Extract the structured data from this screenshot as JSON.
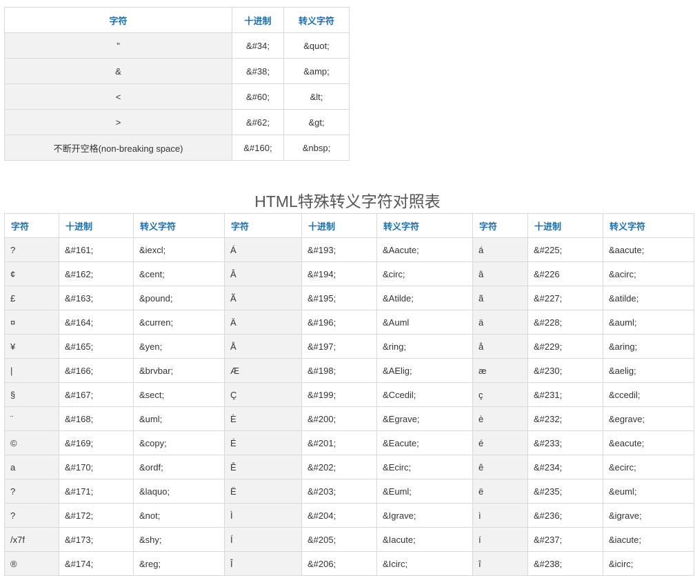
{
  "top_table": {
    "headers": [
      "字符",
      "十进制",
      "转义字符"
    ],
    "rows": [
      [
        "\"",
        "&#34;",
        "&quot;"
      ],
      [
        "&",
        "&#38;",
        "&amp;"
      ],
      [
        "<",
        "&#60;",
        "&lt;"
      ],
      [
        ">",
        "&#62;",
        "&gt;"
      ],
      [
        "不断开空格(non-breaking space)",
        "&#160;",
        "&nbsp;"
      ]
    ]
  },
  "title": "HTML特殊转义字符对照表",
  "main_table": {
    "headers": [
      "字符",
      "十进制",
      "转义字符",
      "字符",
      "十进制",
      "转义字符",
      "字符",
      "十进制",
      "转义字符"
    ],
    "rows": [
      [
        "?",
        "&#161;",
        "&iexcl;",
        "Á",
        "&#193;",
        "&Aacute;",
        "á",
        "&#225;",
        "&aacute;"
      ],
      [
        "¢",
        "&#162;",
        "&cent;",
        "Â",
        "&#194;",
        "&circ;",
        "â",
        "&#226",
        "&acirc;"
      ],
      [
        "£",
        "&#163;",
        "&pound;",
        "Ã",
        "&#195;",
        "&Atilde;",
        "ã",
        "&#227;",
        "&atilde;"
      ],
      [
        "¤",
        "&#164;",
        "&curren;",
        "Ä",
        "&#196;",
        "&Auml",
        "ä",
        "&#228;",
        "&auml;"
      ],
      [
        "¥",
        "&#165;",
        "&yen;",
        "Å",
        "&#197;",
        "&ring;",
        "å",
        "&#229;",
        "&aring;"
      ],
      [
        "|",
        "&#166;",
        "&brvbar;",
        "Æ",
        "&#198;",
        "&AElig;",
        "æ",
        "&#230;",
        "&aelig;"
      ],
      [
        "§",
        "&#167;",
        "&sect;",
        "Ç",
        "&#199;",
        "&Ccedil;",
        "ç",
        "&#231;",
        "&ccedil;"
      ],
      [
        "¨",
        "&#168;",
        "&uml;",
        "È",
        "&#200;",
        "&Egrave;",
        "è",
        "&#232;",
        "&egrave;"
      ],
      [
        "©",
        "&#169;",
        "&copy;",
        "É",
        "&#201;",
        "&Eacute;",
        "é",
        "&#233;",
        "&eacute;"
      ],
      [
        "a",
        "&#170;",
        "&ordf;",
        "Ê",
        "&#202;",
        "&Ecirc;",
        "ê",
        "&#234;",
        "&ecirc;"
      ],
      [
        "?",
        "&#171;",
        "&laquo;",
        "Ë",
        "&#203;",
        "&Euml;",
        "ë",
        "&#235;",
        "&euml;"
      ],
      [
        "?",
        "&#172;",
        "&not;",
        "Ì",
        "&#204;",
        "&Igrave;",
        "ì",
        "&#236;",
        "&igrave;"
      ],
      [
        "/x7f",
        "&#173;",
        "&shy;",
        "Í",
        "&#205;",
        "&Iacute;",
        "í",
        "&#237;",
        "&iacute;"
      ],
      [
        "®",
        "&#174;",
        "&reg;",
        "Î",
        "&#206;",
        "&Icirc;",
        "î",
        "&#238;",
        "&icirc;"
      ]
    ]
  }
}
